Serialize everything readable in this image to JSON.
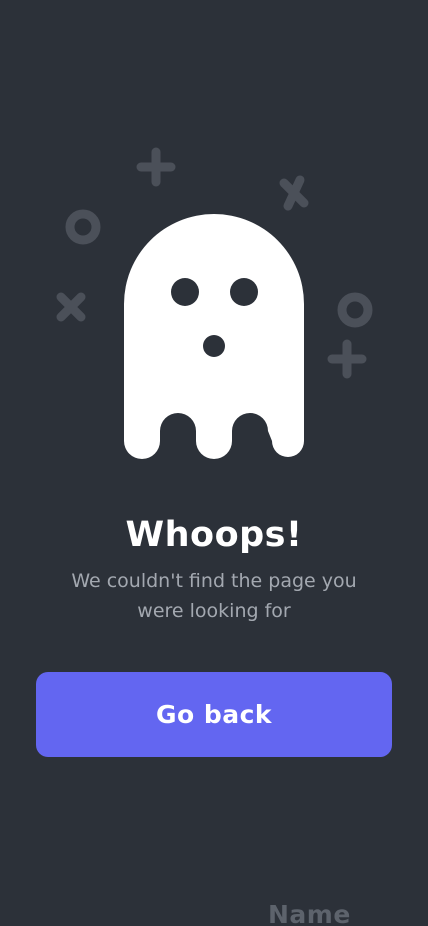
{
  "screen": {
    "background_color": "#2c3139",
    "illustration": {
      "subject": "ghost",
      "ghost_color": "#ffffff",
      "decoration_color": "#4b5059",
      "decorations": [
        "plus-icon",
        "cross-icon",
        "circle-icon",
        "cross-icon",
        "circle-icon",
        "plus-icon"
      ]
    },
    "title": "Whoops!",
    "message": "We couldn't find the page you were looking for",
    "button": {
      "label": "Go back",
      "color": "#6366f1"
    },
    "footer": {
      "name_label": "Name"
    }
  }
}
